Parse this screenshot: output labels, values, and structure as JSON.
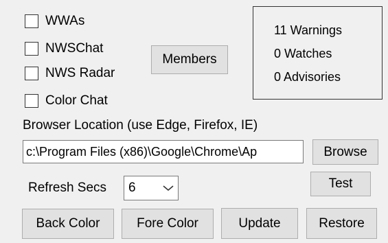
{
  "checkboxes": [
    {
      "label": "WWAs",
      "checked": false
    },
    {
      "label": "NWSChat",
      "checked": false
    },
    {
      "label": "NWS Radar",
      "checked": false
    },
    {
      "label": "Color Chat",
      "checked": false
    }
  ],
  "members_label": "Members",
  "status": {
    "warnings": "11 Warnings",
    "watches": "0 Watches",
    "advisories": "0 Advisories"
  },
  "browser": {
    "label": "Browser Location (use Edge, Firefox, IE)",
    "path": "c:\\Program Files (x86)\\Google\\Chrome\\Ap",
    "browse_label": "Browse"
  },
  "refresh": {
    "label": "Refresh Secs",
    "value": "6"
  },
  "buttons": {
    "test": "Test",
    "back_color": "Back Color",
    "fore_color": "Fore Color",
    "update": "Update",
    "restore": "Restore"
  }
}
